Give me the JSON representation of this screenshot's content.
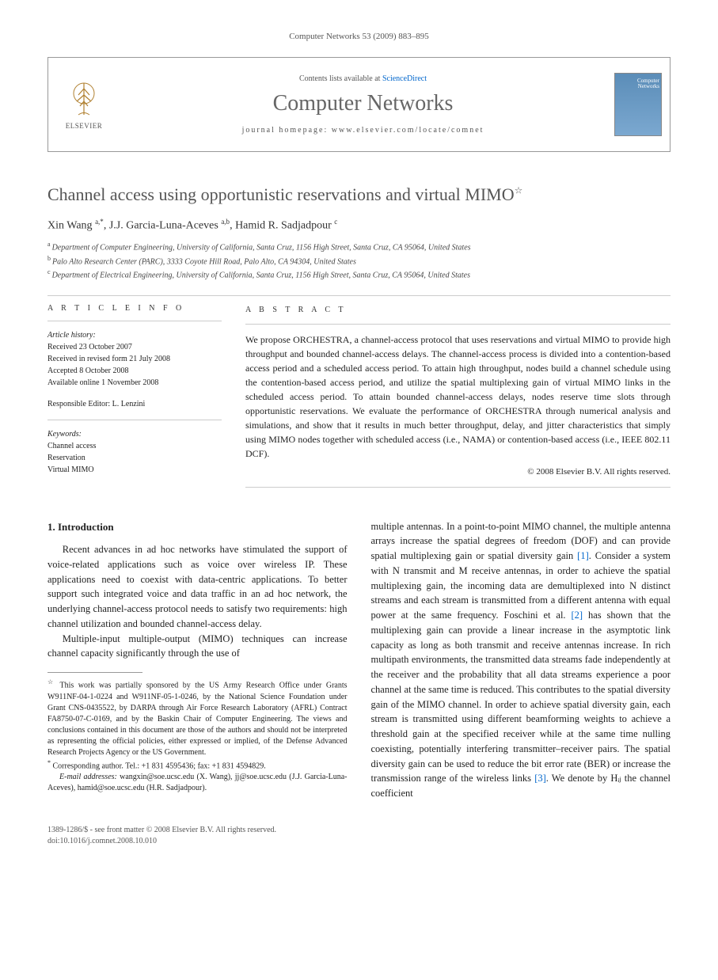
{
  "header_citation": "Computer Networks 53 (2009) 883–895",
  "box": {
    "contents_prefix": "Contents lists available at ",
    "contents_link": "ScienceDirect",
    "journal_name": "Computer Networks",
    "homepage_prefix": "journal homepage: ",
    "homepage_url": "www.elsevier.com/locate/comnet",
    "elsevier_label": "ELSEVIER",
    "cover_label": "Computer Networks"
  },
  "title": "Channel access using opportunistic reservations and virtual MIMO",
  "title_marker": "☆",
  "authors_html": "Xin Wang <sup>a,*</sup>, J.J. Garcia-Luna-Aceves <sup>a,b</sup>, Hamid R. Sadjadpour <sup>c</sup>",
  "affiliations": {
    "a": "Department of Computer Engineering, University of California, Santa Cruz, 1156 High Street, Santa Cruz, CA 95064, United States",
    "b": "Palo Alto Research Center (PARC), 3333 Coyote Hill Road, Palo Alto, CA 94304, United States",
    "c": "Department of Electrical Engineering, University of California, Santa Cruz, 1156 High Street, Santa Cruz, CA 95064, United States"
  },
  "info": {
    "label": "A R T I C L E   I N F O",
    "history_label": "Article history:",
    "received": "Received 23 October 2007",
    "revised": "Received in revised form 21 July 2008",
    "accepted": "Accepted 8 October 2008",
    "online": "Available online 1 November 2008",
    "editor_label": "Responsible Editor:",
    "editor": "L. Lenzini",
    "keywords_label": "Keywords:",
    "keywords": [
      "Channel access",
      "Reservation",
      "Virtual MIMO"
    ]
  },
  "abstract": {
    "label": "A B S T R A C T",
    "text": "We propose ORCHESTRA, a channel-access protocol that uses reservations and virtual MIMO to provide high throughput and bounded channel-access delays. The channel-access process is divided into a contention-based access period and a scheduled access period. To attain high throughput, nodes build a channel schedule using the contention-based access period, and utilize the spatial multiplexing gain of virtual MIMO links in the scheduled access period. To attain bounded channel-access delays, nodes reserve time slots through opportunistic reservations. We evaluate the performance of ORCHESTRA through numerical analysis and simulations, and show that it results in much better throughput, delay, and jitter characteristics that simply using MIMO nodes together with scheduled access (i.e., NAMA) or contention-based access (i.e., IEEE 802.11 DCF).",
    "copyright": "© 2008 Elsevier B.V. All rights reserved."
  },
  "body": {
    "section_num": "1.",
    "section_title": "Introduction",
    "p1": "Recent advances in ad hoc networks have stimulated the support of voice-related applications such as voice over wireless IP. These applications need to coexist with data-centric applications. To better support such integrated voice and data traffic in an ad hoc network, the underlying channel-access protocol needs to satisfy two requirements: high channel utilization and bounded channel-access delay.",
    "p2": "Multiple-input multiple-output (MIMO) techniques can increase channel capacity significantly through the use of",
    "p3_a": "multiple antennas. In a point-to-point MIMO channel, the multiple antenna arrays increase the spatial degrees of freedom (DOF) and can provide spatial multiplexing gain or spatial diversity gain ",
    "ref1": "[1]",
    "p3_b": ". Consider a system with N transmit and M receive antennas, in order to achieve the spatial multiplexing gain, the incoming data are demultiplexed into N distinct streams and each stream is transmitted from a different antenna with equal power at the same frequency. Foschini et al. ",
    "ref2": "[2]",
    "p3_c": " has shown that the multiplexing gain can provide a linear increase in the asymptotic link capacity as long as both transmit and receive antennas increase. In rich multipath environments, the transmitted data streams fade independently at the receiver and the probability that all data streams experience a poor channel at the same time is reduced. This contributes to the spatial diversity gain of the MIMO channel. In order to achieve spatial diversity gain, each stream is transmitted using different beamforming weights to achieve a threshold gain at the specified receiver while at the same time nulling coexisting, potentially interfering transmitter–receiver pairs. The spatial diversity gain can be used to reduce the bit error rate (BER) or increase the transmission range of the wireless links ",
    "ref3": "[3]",
    "p3_d": ". We denote by Hᵢⱼ the channel coefficient"
  },
  "footnotes": {
    "funding_marker": "☆",
    "funding": "This work was partially sponsored by the US Army Research Office under Grants W911NF-04-1-0224 and W911NF-05-1-0246, by the National Science Foundation under Grant CNS-0435522, by DARPA through Air Force Research Laboratory (AFRL) Contract FA8750-07-C-0169, and by the Baskin Chair of Computer Engineering. The views and conclusions contained in this document are those of the authors and should not be interpreted as representing the official policies, either expressed or implied, of the Defense Advanced Research Projects Agency or the US Government.",
    "corr_marker": "*",
    "corr": "Corresponding author. Tel.: +1 831 4595436; fax: +1 831 4594829.",
    "email_label": "E-mail addresses:",
    "emails": "wangxin@soe.ucsc.edu (X. Wang), jj@soe.ucsc.edu (J.J. Garcia-Luna-Aceves), hamid@soe.ucsc.edu (H.R. Sadjadpour)."
  },
  "footer": {
    "line1": "1389-1286/$ - see front matter © 2008 Elsevier B.V. All rights reserved.",
    "line2": "doi:10.1016/j.comnet.2008.10.010"
  }
}
